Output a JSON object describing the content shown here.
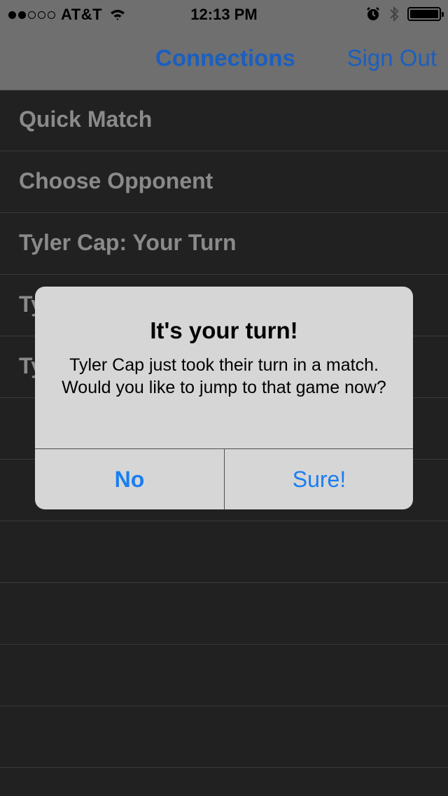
{
  "status_bar": {
    "signal_filled": 2,
    "signal_total": 5,
    "carrier": "AT&T",
    "time": "12:13 PM"
  },
  "nav": {
    "connections_label": "Connections",
    "sign_out_label": "Sign Out"
  },
  "list": {
    "items": [
      {
        "label": "Quick Match"
      },
      {
        "label": "Choose Opponent"
      },
      {
        "label": "Tyler Cap: Your Turn"
      },
      {
        "label": "Ty"
      },
      {
        "label": "Ty"
      },
      {
        "label": ""
      },
      {
        "label": ""
      },
      {
        "label": ""
      },
      {
        "label": ""
      },
      {
        "label": ""
      },
      {
        "label": ""
      }
    ]
  },
  "alert": {
    "title": "It's your turn!",
    "message": "Tyler Cap just took their turn in a match. Would you like to jump to that game now?",
    "no_label": "No",
    "sure_label": "Sure!"
  },
  "colors": {
    "nav_link": "#1a5fbf",
    "alert_button": "#1a7ef0",
    "background": "#212121",
    "row_text": "#8a8a8a"
  },
  "icons": [
    "wifi-icon",
    "alarm-icon",
    "bluetooth-icon",
    "battery-icon"
  ]
}
